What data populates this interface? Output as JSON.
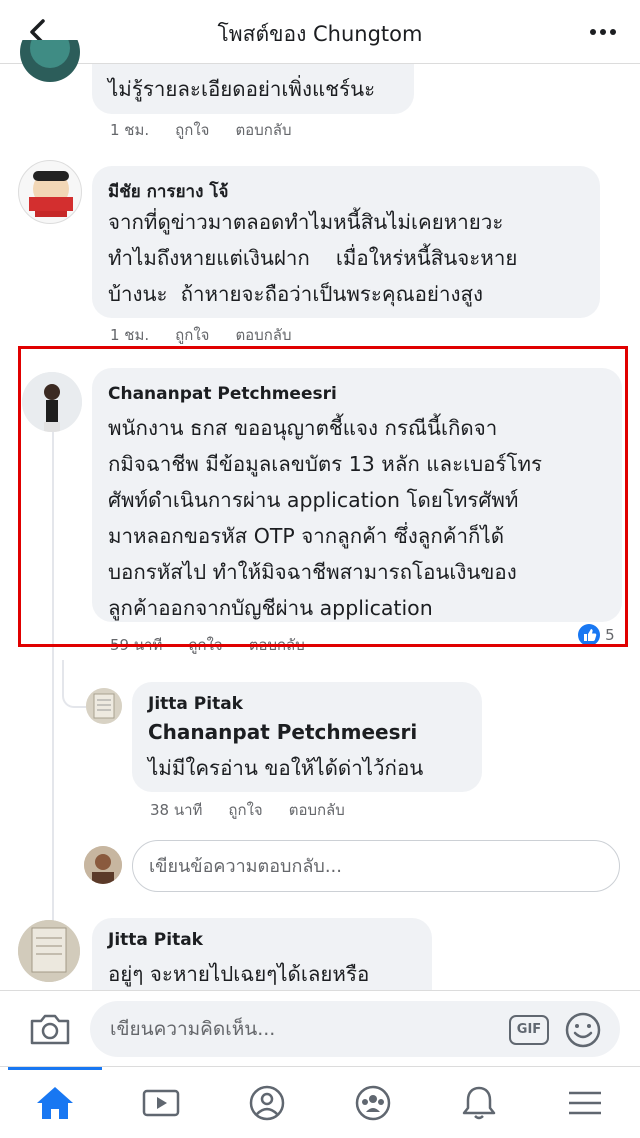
{
  "header": {
    "title": "โพสต์ของ Chungtom"
  },
  "comments": [
    {
      "text_lines": [
        "ไม่รู้รายละเอียดอย่าเพิ่งแชร์นะ"
      ],
      "time": "1 ชม.",
      "like": "ถูกใจ",
      "reply": "ตอบกลับ"
    },
    {
      "author": "มีชัย การยาง โจ้",
      "text_lines": [
        "จากที่ดูข่าวมาตลอดทำไมหนี้สินไม่เคยหายวะ",
        "ทำไมถึงหายแต่เงินฝาก    เมื่อใหร่หนี้สินจะหาย",
        "บ้างนะ  ถ้าหายจะถือว่าเป็นพระคุณอย่างสูง"
      ],
      "time": "1 ชม.",
      "like": "ถูกใจ",
      "reply": "ตอบกลับ"
    },
    {
      "author": "Chananpat Petchmeesri",
      "text_lines": [
        "พนักงาน ธกส ขออนุญาตชี้แจง กรณีนี้เกิดจา",
        "กมิจฉาชีพ มีข้อมูลเลขบัตร 13 หลัก และเบอร์โทร",
        "ศัพท์ดำเนินการผ่าน application โดยโทรศัพท์",
        "มาหลอกขอรหัส OTP จากลูกค้า ซึ่งลูกค้าก็ได้",
        "บอกรหัสไป ทำให้มิจฉาชีพสามารถโอนเงินของ",
        "ลูกค้าออกจากบัญชีผ่าน application"
      ],
      "time": "59 นาที",
      "like": "ถูกใจ",
      "reply": "ตอบกลับ",
      "reaction_count": "5"
    },
    {
      "author": "Jitta Pitak",
      "mention": "Chananpat Petchmeesri",
      "text_lines": [
        "ไม่มีใครอ่าน ขอให้ได้ด่าไว้ก่อน"
      ],
      "time": "38 นาที",
      "like": "ถูกใจ",
      "reply": "ตอบกลับ"
    },
    {
      "author": "Jitta Pitak",
      "text_lines": [
        "อยู่ๆ จะหายไปเฉยๆได้เลยหรือ"
      ]
    }
  ],
  "reply_box": {
    "placeholder": "เขียนข้อความตอบกลับ..."
  },
  "composer": {
    "placeholder": "เขียนความคิดเห็น...",
    "gif_label": "GIF"
  },
  "tabs": [
    "home-icon",
    "video-icon",
    "profile-icon",
    "groups-icon",
    "notifications-icon",
    "menu-icon"
  ],
  "colors": {
    "accent": "#1877f2",
    "highlight": "#e00000",
    "bubble": "#f0f2f5"
  }
}
